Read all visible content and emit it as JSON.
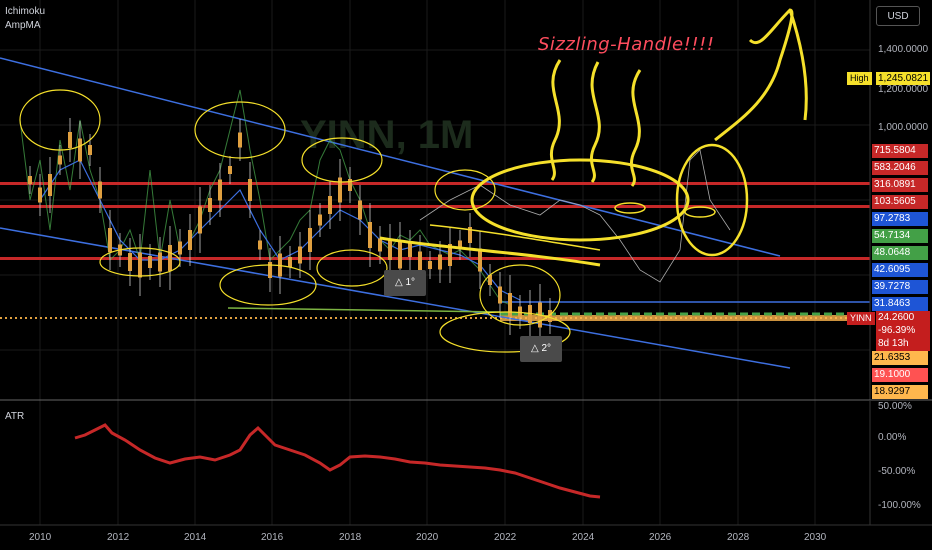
{
  "indicators": {
    "ichimoku": "Ichimoku",
    "ampma": "AmpMA",
    "atr": "ATR"
  },
  "currency": "USD",
  "watermark": "YINN, 1M",
  "annotation": "Sizzling-Handle!!!!",
  "high": {
    "tag": "High",
    "value": "1,245.0821"
  },
  "ticker": {
    "symbol": "YINN",
    "price": "24.2600",
    "change": "-96.39%",
    "countdown": "8d 13h"
  },
  "price_axis_labels": [
    "1,400.0000",
    "1,200.0000",
    "1,000.0000"
  ],
  "price_tags": [
    {
      "value": "715.5804",
      "color": "#c62828"
    },
    {
      "value": "583.2046",
      "color": "#c62828"
    },
    {
      "value": "316.0891",
      "color": "#c62828"
    },
    {
      "value": "103.5605",
      "color": "#c62828"
    },
    {
      "value": "97.2783",
      "color": "#1e55d6"
    },
    {
      "value": "54.7134",
      "color": "#43a047"
    },
    {
      "value": "48.0648",
      "color": "#43a047"
    },
    {
      "value": "42.6095",
      "color": "#1e55d6"
    },
    {
      "value": "39.7278",
      "color": "#1e55d6"
    },
    {
      "value": "31.8463",
      "color": "#1e55d6"
    },
    {
      "value": "21.6353",
      "color": "#ffb74d"
    },
    {
      "value": "19.1000",
      "color": "#ff5252"
    },
    {
      "value": "18.9297",
      "color": "#ffb74d"
    }
  ],
  "atr_axis_labels": [
    "50.00%",
    "0.00%",
    "-50.00%",
    "-100.00%"
  ],
  "x_axis_labels": [
    "2010",
    "2012",
    "2014",
    "2016",
    "2018",
    "2020",
    "2022",
    "2024",
    "2026",
    "2028",
    "2030"
  ],
  "badges": {
    "b1": "1°",
    "b2": "2°"
  },
  "colors": {
    "red_line": "#c62828",
    "blue_line": "#3d6fe0",
    "candle": "#e0a040",
    "atr": "#c62828",
    "annotation": "#f5e02b"
  }
}
